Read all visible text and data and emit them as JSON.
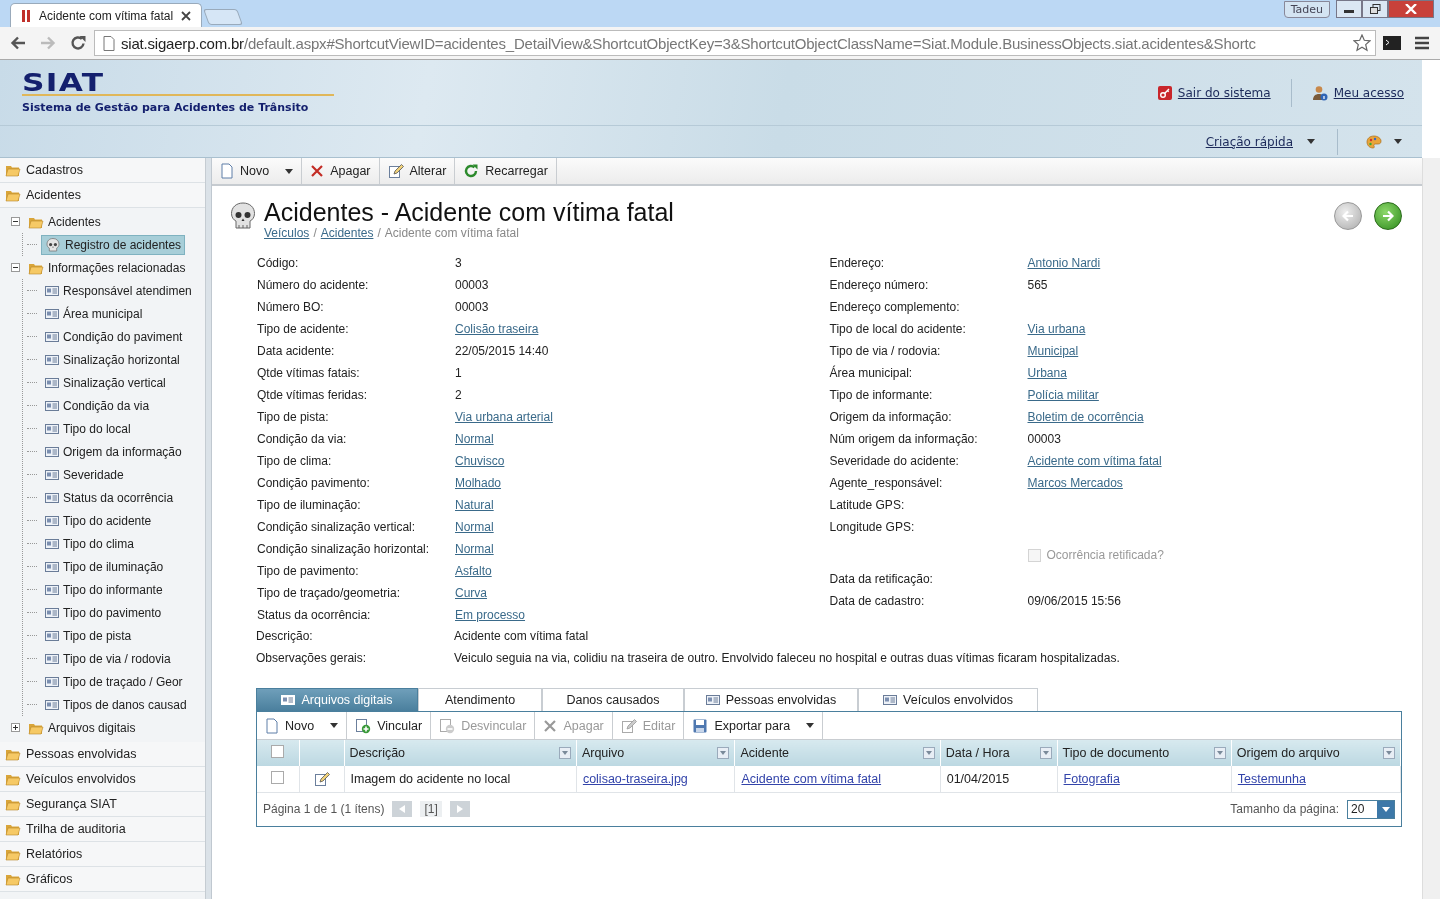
{
  "browser": {
    "tab_title": "Acidente com vítima fatal",
    "user": "Tadeu",
    "url_host": "siat.sigaerp.com.br",
    "url_path": "/default.aspx#ShortcutViewID=acidentes_DetailView&ShortcutObjectKey=3&ShortcutObjectClassName=Siat.Module.BusinessObjects.siat.acidentes&Shortc"
  },
  "header": {
    "logo": "SIAT",
    "subtitle": "Sistema de Gestão para Acidentes de Trânsito",
    "links": [
      "Sair do sistema",
      "Meu acesso"
    ],
    "quick_create": "Criação rápida"
  },
  "sidebar": {
    "items": [
      {
        "label": "Cadastros"
      },
      {
        "label": "Acidentes",
        "children": [
          {
            "label": "Acidentes",
            "kind": "folder",
            "expanded": true,
            "selected": false,
            "children": [
              {
                "label": "Registro de acidentes",
                "kind": "record",
                "selected": true
              }
            ]
          },
          {
            "label": "Informações relacionadas",
            "kind": "folder",
            "expanded": true,
            "selected": false,
            "children": [
              {
                "label": "Responsável atendimen",
                "kind": "list",
                "selected": false
              },
              {
                "label": "Área municipal",
                "kind": "list",
                "selected": false
              },
              {
                "label": "Condição do paviment",
                "kind": "list",
                "selected": false
              },
              {
                "label": "Sinalização horizontal",
                "kind": "list",
                "selected": false
              },
              {
                "label": "Sinalização vertical",
                "kind": "list",
                "selected": false
              },
              {
                "label": "Condição da via",
                "kind": "list",
                "selected": false
              },
              {
                "label": "Tipo do local",
                "kind": "list",
                "selected": false
              },
              {
                "label": "Origem da informação",
                "kind": "list",
                "selected": false
              },
              {
                "label": "Severidade",
                "kind": "list",
                "selected": false
              },
              {
                "label": "Status da ocorrência",
                "kind": "list",
                "selected": false
              },
              {
                "label": "Tipo do acidente",
                "kind": "list",
                "selected": false
              },
              {
                "label": "Tipo do clima",
                "kind": "list",
                "selected": false
              },
              {
                "label": "Tipo de iluminação",
                "kind": "list",
                "selected": false
              },
              {
                "label": "Tipo do informante",
                "kind": "list",
                "selected": false
              },
              {
                "label": "Tipo do pavimento",
                "kind": "list",
                "selected": false
              },
              {
                "label": "Tipo de pista",
                "kind": "list",
                "selected": false
              },
              {
                "label": "Tipo de via / rodovia",
                "kind": "list",
                "selected": false
              },
              {
                "label": "Tipo de traçado / Geor",
                "kind": "list",
                "selected": false
              },
              {
                "label": "Tipos de danos causad",
                "kind": "list",
                "selected": false
              }
            ]
          },
          {
            "label": "Arquivos digitais",
            "kind": "folder",
            "expanded": false,
            "selected": false
          }
        ]
      },
      {
        "label": "Pessoas envolvidas"
      },
      {
        "label": "Veículos envolvidos"
      },
      {
        "label": "Segurança SIAT"
      },
      {
        "label": "Trilha de auditoria"
      },
      {
        "label": "Relatórios"
      },
      {
        "label": "Gráficos"
      }
    ]
  },
  "toolbar": [
    {
      "label": "Novo",
      "kind": "new",
      "dropdown": true
    },
    {
      "label": "Apagar",
      "kind": "delete",
      "dropdown": false
    },
    {
      "label": "Alterar",
      "kind": "edit",
      "dropdown": false
    },
    {
      "label": "Recarregar",
      "kind": "reload",
      "dropdown": false
    }
  ],
  "record": {
    "title": "Acidentes - Acidente com vítima fatal",
    "breadcrumb": [
      {
        "kind": "link",
        "label": "Veículos"
      },
      {
        "kind": "separator",
        "label": "/"
      },
      {
        "kind": "link",
        "label": "Acidentes"
      },
      {
        "kind": "separator",
        "label": "/"
      },
      {
        "kind": "current",
        "label": "Acidente com vítima fatal"
      }
    ]
  },
  "fields_left": [
    {
      "kind": "field",
      "label": "Código:",
      "value": "3",
      "link": false
    },
    {
      "kind": "field",
      "label": "Número do acidente:",
      "value": "00003",
      "link": false
    },
    {
      "kind": "field",
      "label": "Número BO:",
      "value": "00003",
      "link": false
    },
    {
      "kind": "field",
      "label": "Tipo de acidente:",
      "value": "Colisão traseira",
      "link": true
    },
    {
      "kind": "field",
      "label": "Data acidente:",
      "value": "22/05/2015 14:40",
      "link": false
    },
    {
      "kind": "field",
      "label": "Qtde vítimas fatais:",
      "value": "1",
      "link": false
    },
    {
      "kind": "field",
      "label": "Qtde vítimas feridas:",
      "value": "2",
      "link": false
    },
    {
      "kind": "field",
      "label": "Tipo de pista:",
      "value": "Via urbana arterial",
      "link": true
    },
    {
      "kind": "field",
      "label": "Condição da via:",
      "value": "Normal",
      "link": true
    },
    {
      "kind": "field",
      "label": "Tipo de clima:",
      "value": "Chuvisco",
      "link": true
    },
    {
      "kind": "field",
      "label": "Condição pavimento:",
      "value": "Molhado",
      "link": true
    },
    {
      "kind": "field",
      "label": "Tipo de iluminação:",
      "value": "Natural",
      "link": true
    },
    {
      "kind": "field",
      "label": "Condição sinalização vertical:",
      "value": "Normal",
      "link": true
    },
    {
      "kind": "field",
      "label": "Condição sinalização horizontal:",
      "value": "Normal",
      "link": true
    },
    {
      "kind": "field",
      "label": "Tipo de pavimento:",
      "value": "Asfalto",
      "link": true
    },
    {
      "kind": "field",
      "label": "Tipo de traçado/geometria:",
      "value": "Curva",
      "link": true
    },
    {
      "kind": "field",
      "label": "Status da ocorrência:",
      "value": "Em processo",
      "link": true
    }
  ],
  "fields_right": [
    {
      "kind": "field",
      "label": "Endereço:",
      "value": "Antonio Nardi",
      "link": true
    },
    {
      "kind": "field",
      "label": "Endereço número:",
      "value": "565",
      "link": false
    },
    {
      "kind": "field",
      "label": "Endereço complemento:"
    },
    {
      "kind": "field",
      "label": "Tipo de local do acidente:",
      "value": "Via urbana",
      "link": true
    },
    {
      "kind": "field",
      "label": "Tipo de via / rodovia:",
      "value": "Municipal",
      "link": true
    },
    {
      "kind": "field",
      "label": "Área municipal:",
      "value": "Urbana",
      "link": true
    },
    {
      "kind": "field",
      "label": "Tipo de informante:",
      "value": "Polícia militar",
      "link": true
    },
    {
      "kind": "field",
      "label": "Origem da informação:",
      "value": "Boletim de ocorrência",
      "link": true
    },
    {
      "kind": "field",
      "label": "Núm origem da informação:",
      "value": "00003",
      "link": false
    },
    {
      "kind": "field",
      "label": "Severidade do acidente:",
      "value": "Acidente com vítima fatal",
      "link": true
    },
    {
      "kind": "field",
      "label": "Agente_responsável:",
      "value": "Marcos Mercados",
      "link": true
    },
    {
      "kind": "field",
      "label": "Latitude GPS:"
    },
    {
      "kind": "field",
      "label": "Longitude GPS:"
    },
    {
      "kind": "checkbox",
      "label": "Ocorrência retificada?",
      "checked": false,
      "disabled": true
    },
    {
      "kind": "field",
      "label": "Data da retificação:"
    },
    {
      "kind": "field",
      "label": "Data de cadastro:",
      "value": "09/06/2015 15:56",
      "link": false
    }
  ],
  "fields_wide": [
    {
      "label": "Descrição:",
      "value": "Acidente com vítima fatal"
    },
    {
      "label": "Observações gerais:",
      "value": "Veiculo seguia na via, colidiu na traseira de outro. Envolvido faleceu no hospital e outras duas vítimas ficaram hospitalizadas."
    }
  ],
  "detail_tabs": [
    {
      "label": "Arquivos digitais",
      "kind": "list",
      "selected": true
    },
    {
      "label": "Atendimento",
      "kind": "detail",
      "selected": false
    },
    {
      "label": "Danos causados",
      "kind": "detail",
      "selected": false
    },
    {
      "label": "Pessoas envolvidas",
      "kind": "list",
      "selected": false
    },
    {
      "label": "Veículos envolvidos",
      "kind": "list",
      "selected": false
    }
  ],
  "grid_toolbar": [
    {
      "label": "Novo",
      "kind": "new",
      "dropdown": true,
      "disabled": false
    },
    {
      "label": "Vincular",
      "kind": "link",
      "dropdown": false,
      "disabled": false
    },
    {
      "label": "Desvincular",
      "kind": "unlink",
      "dropdown": false,
      "disabled": true
    },
    {
      "label": "Apagar",
      "kind": "delete",
      "dropdown": false,
      "disabled": true
    },
    {
      "label": "Editar",
      "kind": "edit",
      "dropdown": false,
      "disabled": true
    },
    {
      "label": "Exportar para",
      "kind": "export",
      "dropdown": true,
      "disabled": false
    }
  ],
  "grid": {
    "all_checked": false,
    "columns": [
      "Descrição",
      "Arquivo",
      "Acidente",
      "Data / Hora",
      "Tipo de documento",
      "Origem do arquivo"
    ],
    "rows": [
      {
        "checked": false,
        "cells": [
          {
            "text": "Imagem do acidente no local",
            "link": false
          },
          {
            "text": "colisao-traseira.jpg",
            "link": true
          },
          {
            "text": "Acidente com vítima fatal",
            "link": true
          },
          {
            "text": "01/04/2015",
            "link": false
          },
          {
            "text": "Fotografia",
            "link": true
          },
          {
            "text": "Testemunha",
            "link": true
          }
        ]
      }
    ],
    "pager": {
      "info": "Página 1 de 1 (1 ítens)",
      "current": "[1]",
      "size_label": "Tamanho da página:",
      "size": "20"
    }
  }
}
